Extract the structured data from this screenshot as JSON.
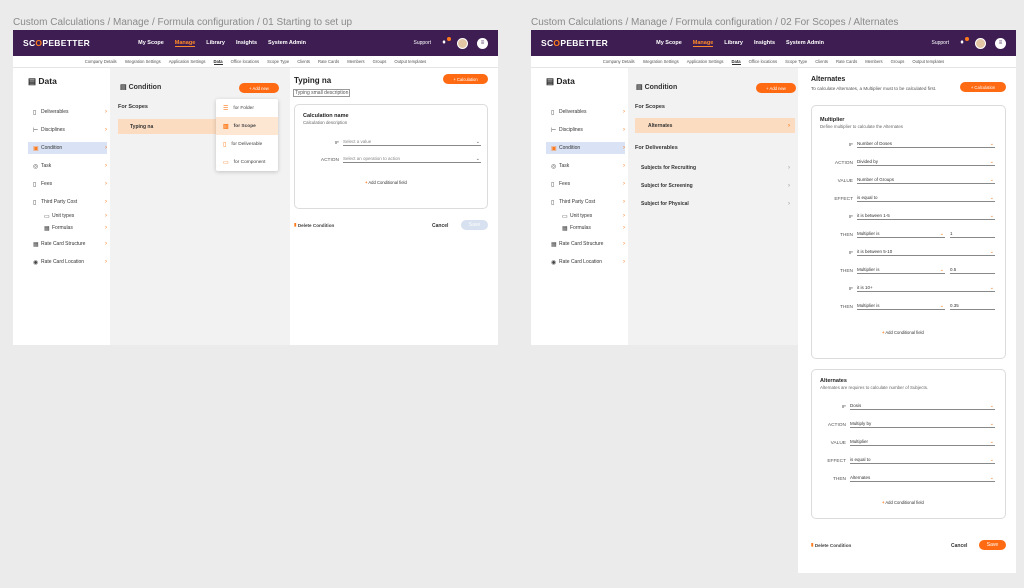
{
  "frames": [
    {
      "label": "Custom Calculations / Manage / Formula configuration / 01 Starting to set up"
    },
    {
      "label": "Custom Calculations / Manage / Formula configuration / 02 For Scopes / Alternates"
    }
  ],
  "topbar": {
    "logo_a": "SC",
    "logo_o": "O",
    "logo_b": "PE",
    "logo_c": "BETTER",
    "nav": [
      "My Scope",
      "Manage",
      "Library",
      "Insights",
      "System Admin"
    ],
    "support": "Support"
  },
  "subnav": [
    "Company Details",
    "Integration Settings",
    "Application Settings",
    "Data",
    "Office locations",
    "Scope Type",
    "Clients",
    "Rate Cards",
    "Members",
    "Groups",
    "Output templates"
  ],
  "sidebar": {
    "title": "Data",
    "items": [
      "Deliverables",
      "Disciplines",
      "Condition",
      "Task",
      "Fees",
      "Third Party Cost",
      "Unit types",
      "Formulas",
      "Rate Card Structure",
      "Rate Card Location"
    ]
  },
  "screen1": {
    "col_title": "Condition",
    "add_new": "+ Add new",
    "for_scopes": "For Scopes",
    "typing_item": "Typing na",
    "dropdown": [
      "for Folder",
      "for Scope",
      "for Deliverable",
      "for Component"
    ],
    "calc_btn": "+ Calculation",
    "name_value": "Typing na",
    "desc_value": "Typing small description",
    "card_title": "Calculation name",
    "card_sub": "Calculation description",
    "if_label": "IF",
    "if_placeholder": "Select a value",
    "action_label": "ACTION",
    "action_placeholder": "Select an operation to action",
    "add_field": "Add Conditional field",
    "delete": "Delete Condition",
    "cancel": "Cancel",
    "save": "Save"
  },
  "screen2": {
    "col_title": "Condition",
    "add_new": "+ Add new",
    "for_scopes": "For Scopes",
    "alternates_item": "Alternates",
    "for_deliverables": "For Deliverables",
    "deliverables": [
      "Subjects for Recruiting",
      "Subject for Screening",
      "Subject for Physical"
    ],
    "panel_title": "Alternates",
    "panel_desc": "To calculate Alternates, a Multiplier must to be calculated first.",
    "calc_btn": "+ Calculation",
    "multiplier": {
      "title": "Multiplier",
      "sub": "Define multiplier to calculate the Alternates",
      "rows": [
        {
          "label": "IF",
          "value": "Number of Doses"
        },
        {
          "label": "ACTION",
          "value": "Divided by"
        },
        {
          "label": "VALUE",
          "value": "Number of Groups"
        },
        {
          "label": "EFFECT",
          "value": "is equal to"
        },
        {
          "label": "IF",
          "value": "it is between 1-5"
        },
        {
          "label": "THEN",
          "value": "Multiplier is",
          "num": "1"
        },
        {
          "label": "IF",
          "value": "it is between 5-10"
        },
        {
          "label": "THEN",
          "value": "Multiplier is",
          "num": "0.5"
        },
        {
          "label": "IF",
          "value": "it is 10+"
        },
        {
          "label": "THEN",
          "value": "Multiplier is",
          "num": "0.35"
        }
      ],
      "add_field": "Add Conditional field"
    },
    "alternates": {
      "title": "Alternates",
      "sub": "Alternates are requires to calculate number of Subjects.",
      "rows": [
        {
          "label": "IF",
          "value": "Dosis"
        },
        {
          "label": "ACTION",
          "value": "Multiply by"
        },
        {
          "label": "VALUE",
          "value": "Multiplier"
        },
        {
          "label": "EFFECT",
          "value": "is equal to"
        },
        {
          "label": "THEN",
          "value": "Alternates"
        }
      ],
      "add_field": "Add Conditional field"
    },
    "delete": "Delete Condition",
    "cancel": "Cancel",
    "save": "Save"
  },
  "colors": {
    "brand": "#3e1e52",
    "accent": "#ff6a13",
    "selected": "#d9e3f5"
  }
}
